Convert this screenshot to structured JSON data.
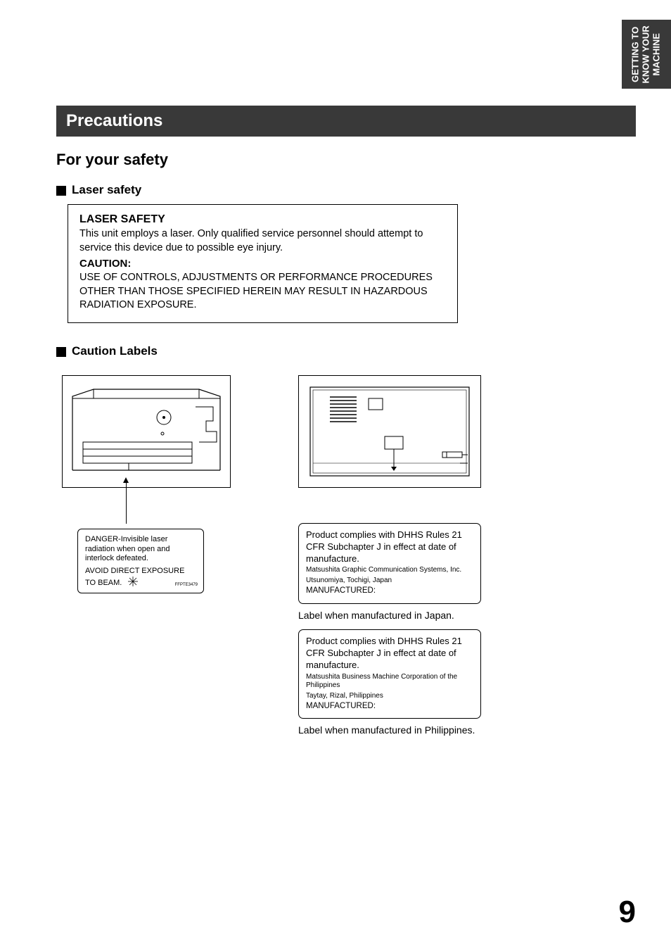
{
  "sideTab": {
    "line1": "GETTING TO",
    "line2": "KNOW YOUR",
    "line3": "MACHINE"
  },
  "sectionTitle": "Precautions",
  "h2": "For your safety",
  "laserHeading": "Laser safety",
  "safetyBox": {
    "title": "LASER SAFETY",
    "text": "This unit employs a laser. Only qualified service personnel should attempt to service this device due to possible eye injury.",
    "cautionTitle": "CAUTION:",
    "cautionText": "USE OF CONTROLS, ADJUSTMENTS OR PERFORMANCE PROCEDURES OTHER THAN THOSE SPECIFIED HEREIN MAY RESULT IN HAZARDOUS RADIATION EXPOSURE."
  },
  "cautionLabelsHeading": "Caution Labels",
  "leftLabel": {
    "t1": "DANGER-Invisible laser radiation when open and interlock defeated.",
    "t2": "AVOID DIRECT EXPOSURE TO BEAM.",
    "micro": "FFPTE3479"
  },
  "rightLabel1": {
    "comp": "Product complies with DHHS Rules 21 CFR Subchapter  J  in  effect at  date of manufacture.",
    "mfr": "Matsushita Graphic Communication Systems, Inc.",
    "loc": "Utsunomiya,   Tochigi,   Japan",
    "made": "MANUFACTURED:"
  },
  "rightCaption1": "Label when manufactured in Japan.",
  "rightLabel2": {
    "comp": "Product complies with DHHS Rules 21 CFR Subchapter  J  in  effect at  date of manufacture.",
    "mfr": "Matsushita Business Machine Corporation of the Philippines",
    "loc": "Taytay,   Rizal,   Philippines",
    "made": "MANUFACTURED:"
  },
  "rightCaption2": "Label when manufactured in Philippines.",
  "pageNumber": "9"
}
